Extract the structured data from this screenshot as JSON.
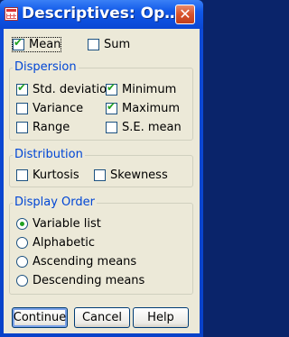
{
  "window": {
    "title": "Descriptives: Op…",
    "close_symbol": "✕"
  },
  "top": {
    "mean": {
      "label": "Mean",
      "checked": true
    },
    "sum": {
      "label": "Sum",
      "checked": false
    }
  },
  "dispersion": {
    "legend": "Dispersion",
    "std_deviation": {
      "label": "Std. deviation",
      "checked": true
    },
    "minimum": {
      "label": "Minimum",
      "checked": true
    },
    "variance": {
      "label": "Variance",
      "checked": false
    },
    "maximum": {
      "label": "Maximum",
      "checked": true
    },
    "range": {
      "label": "Range",
      "checked": false
    },
    "se_mean": {
      "label": "S.E. mean",
      "checked": false
    }
  },
  "distribution": {
    "legend": "Distribution",
    "kurtosis": {
      "label": "Kurtosis",
      "checked": false
    },
    "skewness": {
      "label": "Skewness",
      "checked": false
    }
  },
  "display_order": {
    "legend": "Display Order",
    "options": [
      "Variable list",
      "Alphabetic",
      "Ascending means",
      "Descending means"
    ],
    "selected": "Variable list"
  },
  "buttons": {
    "continue": "Continue",
    "cancel": "Cancel",
    "help": "Help"
  },
  "colors": {
    "title_bar": "#0a47d4",
    "dialog_bg": "#ece9d8",
    "legend_text": "#0046d5",
    "check_mark": "#21a121"
  }
}
